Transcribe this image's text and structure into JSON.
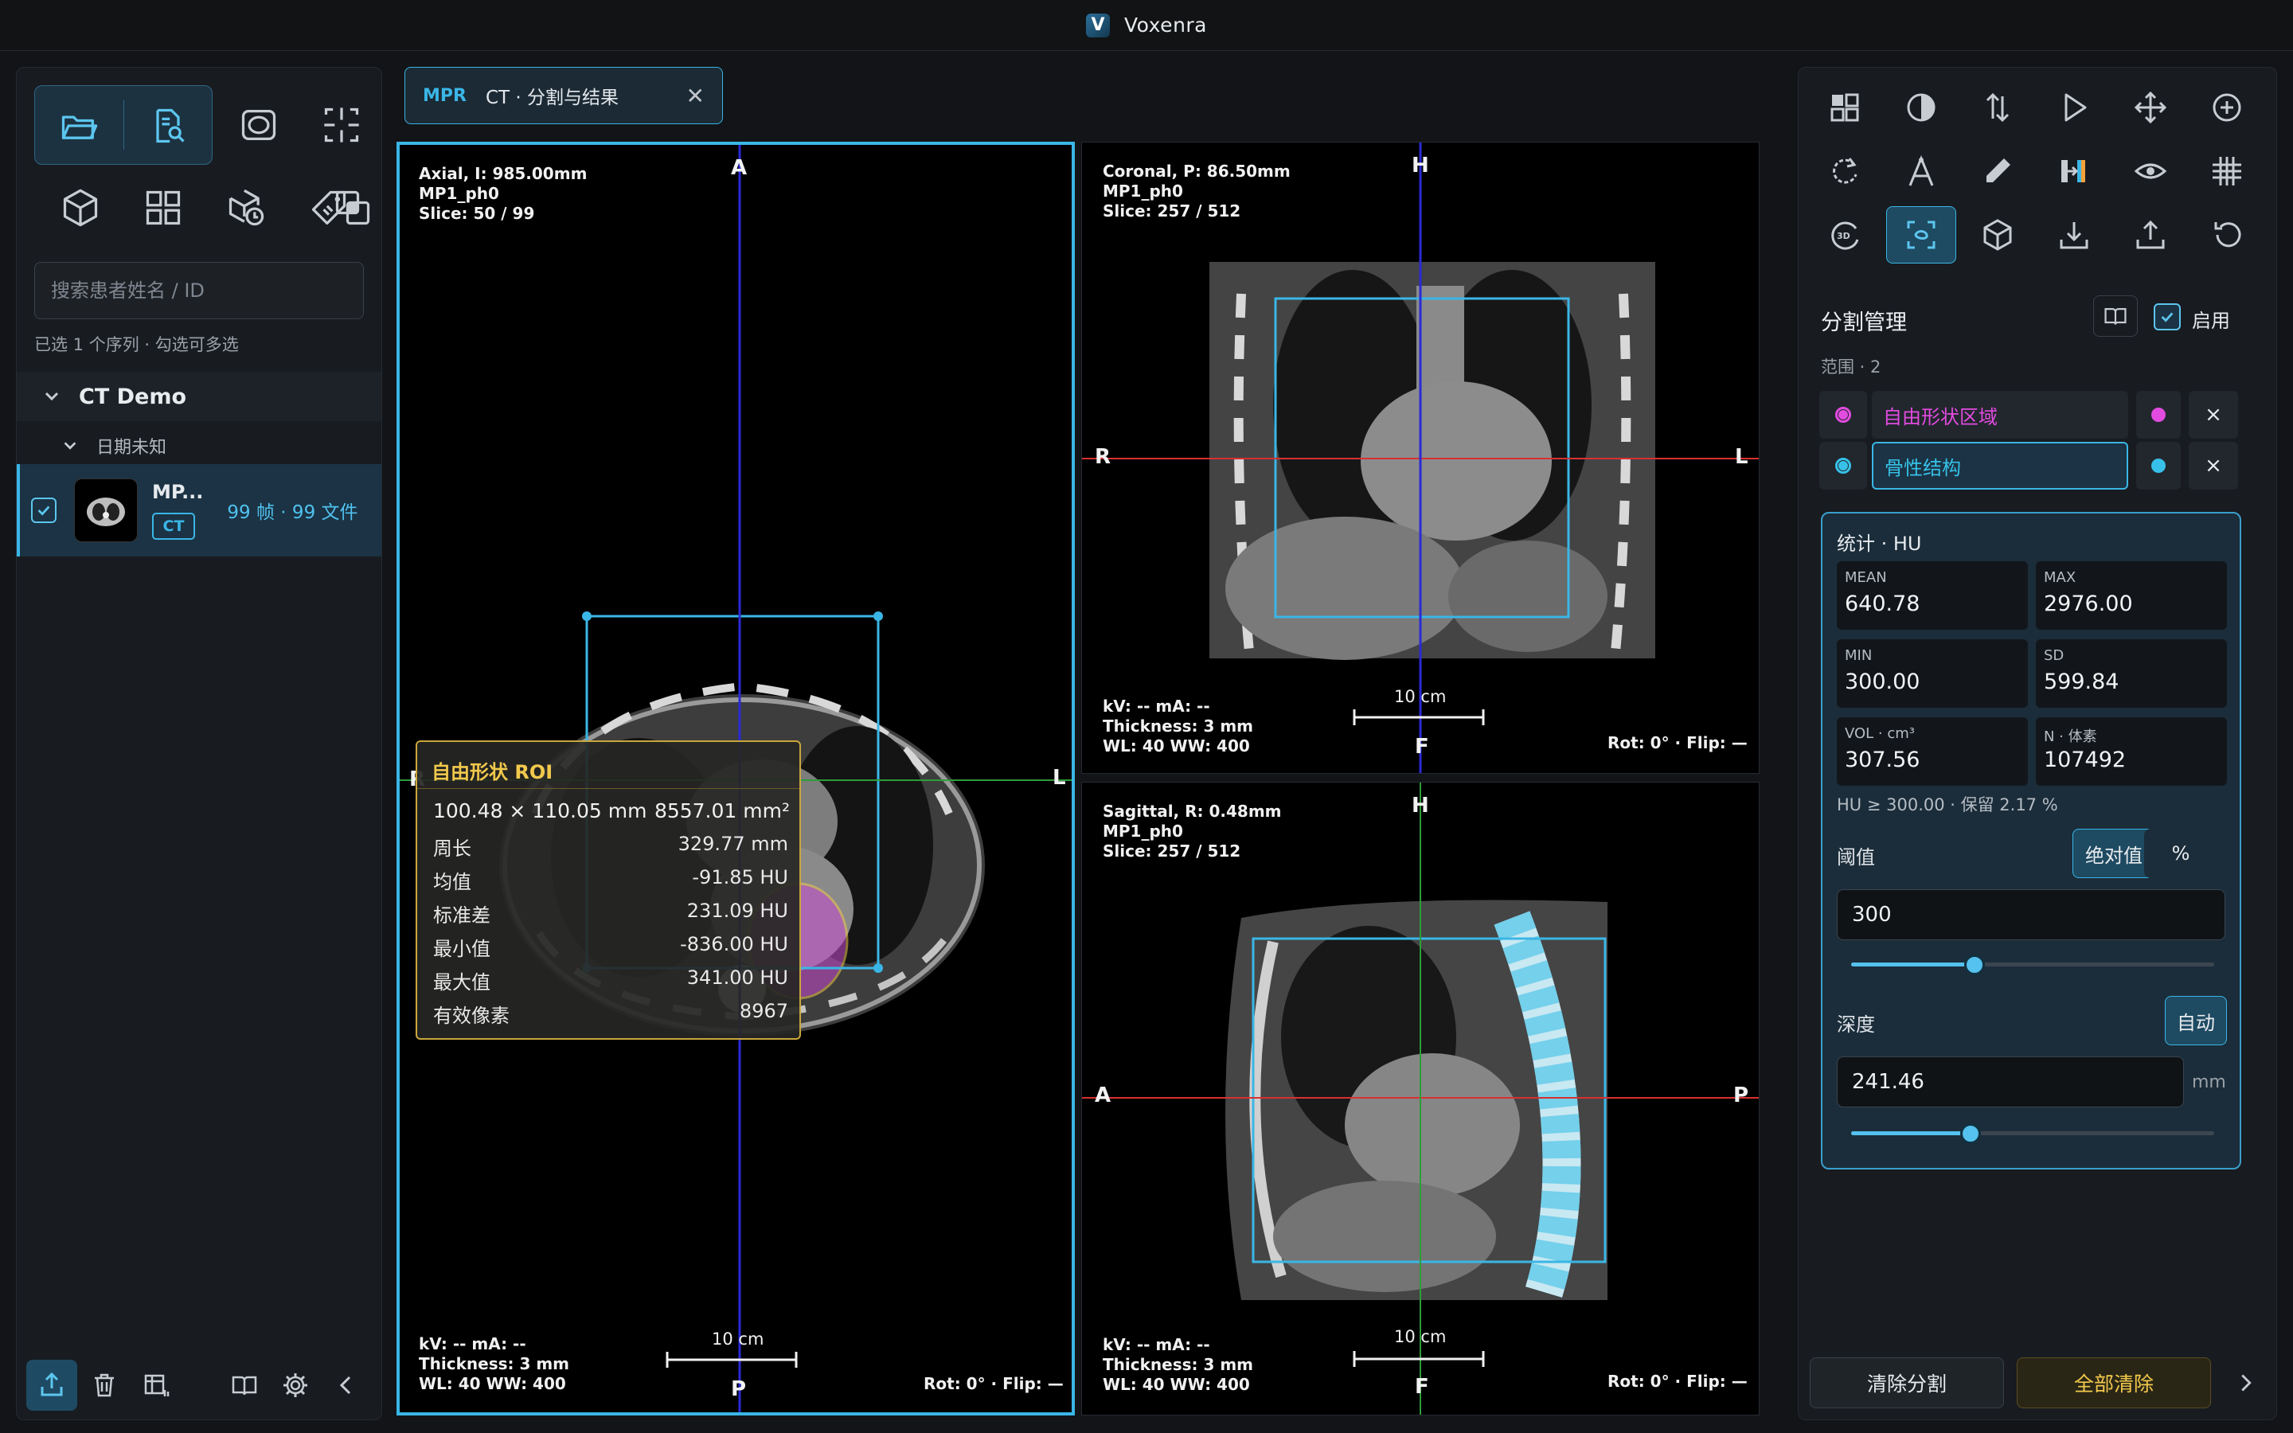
{
  "app": {
    "title": "Voxenra",
    "logo_letter": "V"
  },
  "sidebar": {
    "search_placeholder": "搜索患者姓名 / ID",
    "selection_info": "已选 1 个序列 · 勾选可多选",
    "tree": {
      "root_label": "CT Demo",
      "sub_label": "日期未知",
      "series": {
        "name": "MP...",
        "modality": "CT",
        "count": "99 帧 · 99 文件"
      }
    }
  },
  "tab": {
    "mode": "MPR",
    "name": "CT · 分割与结果",
    "close": "✕"
  },
  "viewports": {
    "axial": {
      "info": [
        "Axial, I: 985.00mm",
        "MP1_ph0",
        "Slice: 50 / 99"
      ],
      "bottom_info": [
        "kV: --   mA: --",
        "Thickness: 3 mm",
        "WL: 40   WW: 400"
      ],
      "rot": "Rot: 0° · Flip: —",
      "scale": "10 cm",
      "orient": {
        "top": "A",
        "bottom": "P",
        "left": "R",
        "right": "L"
      }
    },
    "coronal": {
      "info": [
        "Coronal, P: 86.50mm",
        "MP1_ph0",
        "Slice: 257 / 512"
      ],
      "bottom_info": [
        "kV: --   mA: --",
        "Thickness: 3 mm",
        "WL: 40   WW: 400"
      ],
      "rot": "Rot: 0° · Flip: —",
      "scale": "10 cm",
      "orient": {
        "top": "H",
        "bottom": "F",
        "left": "R",
        "right": "L"
      }
    },
    "sagittal": {
      "info": [
        "Sagittal, R: 0.48mm",
        "MP1_ph0",
        "Slice: 257 / 512"
      ],
      "bottom_info": [
        "kV: --   mA: --",
        "Thickness: 3 mm",
        "WL: 40   WW: 400"
      ],
      "rot": "Rot: 0° · Flip: —",
      "scale": "10 cm",
      "orient": {
        "top": "H",
        "bottom": "F",
        "left": "A",
        "right": "P"
      }
    }
  },
  "roi": {
    "title": "自由形状 ROI",
    "size": "100.48 × 110.05 mm",
    "area": "8557.01 mm²",
    "rows": [
      {
        "label": "周长",
        "value": "329.77 mm"
      },
      {
        "label": "均值",
        "value": "-91.85 HU"
      },
      {
        "label": "标准差",
        "value": "231.09 HU"
      },
      {
        "label": "最小值",
        "value": "-836.00 HU"
      },
      {
        "label": "最大值",
        "value": "341.00 HU"
      },
      {
        "label": "有效像素",
        "value": "8967"
      }
    ]
  },
  "segmentation": {
    "title": "分割管理",
    "enable_label": "启用",
    "scope": "范围 · 2",
    "items": [
      {
        "name": "自由形状区域",
        "color": "#e24be0"
      },
      {
        "name": "骨性结构",
        "color": "#37c1e8"
      }
    ],
    "delete_symbol": "×",
    "stats": {
      "title": "统计 · HU",
      "cells": [
        {
          "key": "MEAN",
          "value": "640.78"
        },
        {
          "key": "MAX",
          "value": "2976.00"
        },
        {
          "key": "MIN",
          "value": "300.00"
        },
        {
          "key": "SD",
          "value": "599.84"
        },
        {
          "key": "VOL · cm³",
          "value": "307.56"
        },
        {
          "key": "N · 体素",
          "value": "107492"
        }
      ],
      "note": "HU ≥ 300.00 · 保留 2.17 %",
      "threshold_label": "阈值",
      "threshold_mode_abs": "绝对值",
      "threshold_mode_pct": "%",
      "threshold_value": "300",
      "threshold_slider": 0.34,
      "depth_label": "深度",
      "depth_auto": "自动",
      "depth_value": "241.46",
      "depth_unit": "mm",
      "depth_slider": 0.33
    },
    "buttons": {
      "clear": "清除分割",
      "clear_all": "全部清除"
    }
  },
  "colors": {
    "accent": "#3ab6e6",
    "roi": "#f2c94c",
    "seg_magenta": "#e24be0",
    "seg_cyan": "#37c1e8"
  }
}
